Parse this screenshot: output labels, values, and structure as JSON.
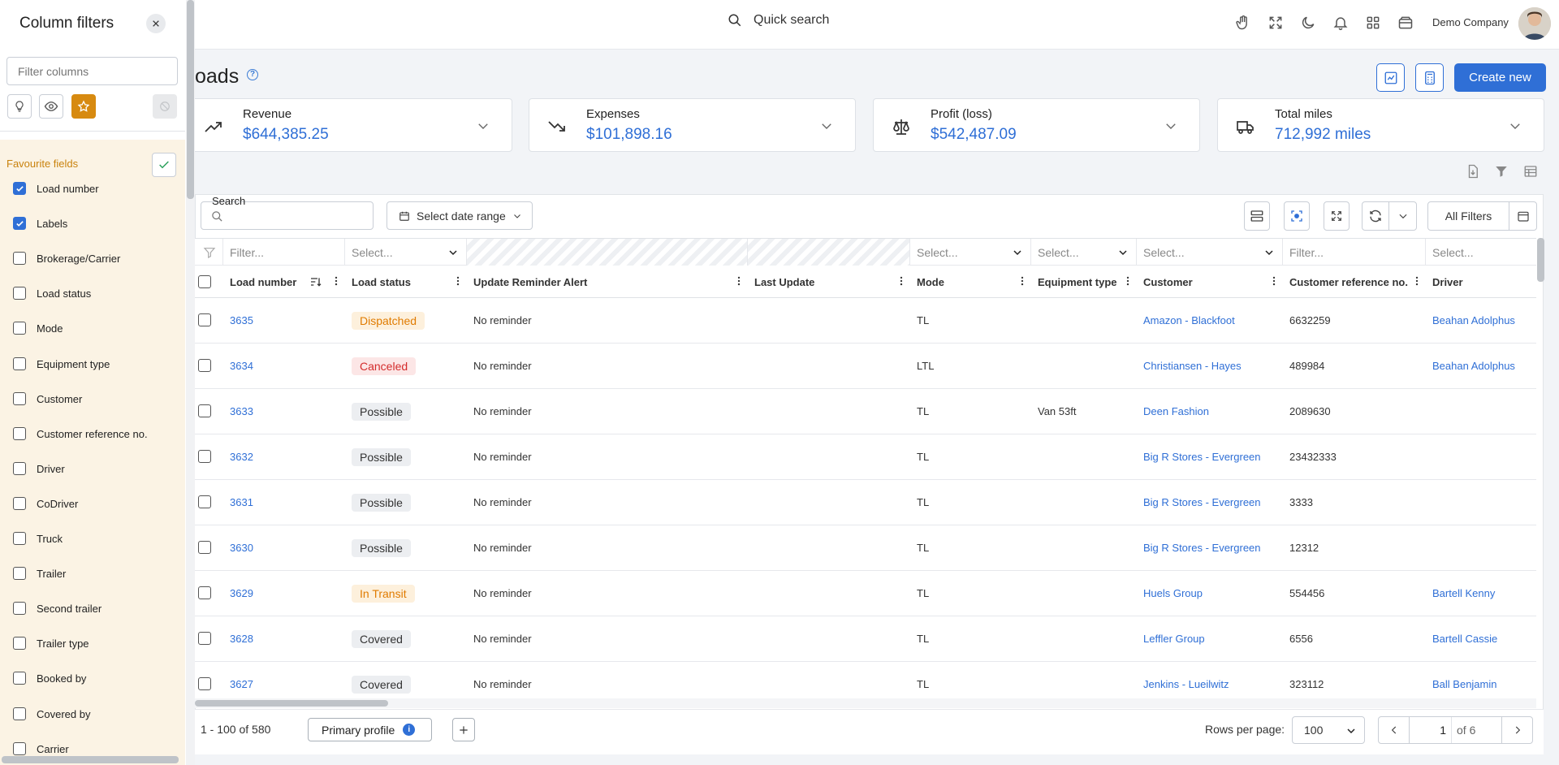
{
  "topbar": {
    "quick_search": "Quick search",
    "company": "Demo Company"
  },
  "page": {
    "title": "oads",
    "create_new": "Create new"
  },
  "stats": [
    {
      "label": "Revenue",
      "value": "$644,385.25",
      "icon": "trend-up-icon"
    },
    {
      "label": "Expenses",
      "value": "$101,898.16",
      "icon": "trend-down-icon"
    },
    {
      "label": "Profit (loss)",
      "value": "$542,487.09",
      "icon": "scale-icon"
    },
    {
      "label": "Total miles",
      "value": "712,992 miles",
      "icon": "truck-icon"
    }
  ],
  "toolbar": {
    "search_label": "Search",
    "date_range": "Select date range",
    "all_filters": "All Filters"
  },
  "filters": {
    "text": "Filter...",
    "select": "Select..."
  },
  "columns": [
    "Load number",
    "Load status",
    "Update Reminder Alert",
    "Last Update",
    "Mode",
    "Equipment type",
    "Customer",
    "Customer reference no.",
    "Driver"
  ],
  "rows": [
    {
      "load": "3635",
      "status": "Dispatched",
      "status_kind": "orange",
      "reminder": "No reminder",
      "mode": "TL",
      "equipment": "",
      "customer": "Amazon - Blackfoot",
      "ref": "6632259",
      "driver": "Beahan Adolphus"
    },
    {
      "load": "3634",
      "status": "Canceled",
      "status_kind": "red",
      "reminder": "No reminder",
      "mode": "LTL",
      "equipment": "",
      "customer": "Christiansen - Hayes",
      "ref": "489984",
      "driver": "Beahan Adolphus"
    },
    {
      "load": "3633",
      "status": "Possible",
      "status_kind": "gray",
      "reminder": "No reminder",
      "mode": "TL",
      "equipment": "Van 53ft",
      "customer": "Deen Fashion",
      "ref": "2089630",
      "driver": ""
    },
    {
      "load": "3632",
      "status": "Possible",
      "status_kind": "gray",
      "reminder": "No reminder",
      "mode": "TL",
      "equipment": "",
      "customer": "Big R Stores - Evergreen",
      "ref": "23432333",
      "driver": ""
    },
    {
      "load": "3631",
      "status": "Possible",
      "status_kind": "gray",
      "reminder": "No reminder",
      "mode": "TL",
      "equipment": "",
      "customer": "Big R Stores - Evergreen",
      "ref": "3333",
      "driver": ""
    },
    {
      "load": "3630",
      "status": "Possible",
      "status_kind": "gray",
      "reminder": "No reminder",
      "mode": "TL",
      "equipment": "",
      "customer": "Big R Stores - Evergreen",
      "ref": "12312",
      "driver": ""
    },
    {
      "load": "3629",
      "status": "In Transit",
      "status_kind": "orange",
      "reminder": "No reminder",
      "mode": "TL",
      "equipment": "",
      "customer": "Huels Group",
      "ref": "554456",
      "driver": "Bartell Kenny"
    },
    {
      "load": "3628",
      "status": "Covered",
      "status_kind": "gray",
      "reminder": "No reminder",
      "mode": "TL",
      "equipment": "",
      "customer": "Leffler Group",
      "ref": "6556",
      "driver": "Bartell Cassie"
    },
    {
      "load": "3627",
      "status": "Covered",
      "status_kind": "gray",
      "reminder": "No reminder",
      "mode": "TL",
      "equipment": "",
      "customer": "Jenkins - Lueilwitz",
      "ref": "323112",
      "driver": "Ball Benjamin"
    }
  ],
  "footer": {
    "range": "1 - 100 of 580",
    "profile": "Primary profile",
    "rows_per_page_label": "Rows per page:",
    "rows_per_page": "100",
    "page": "1",
    "of_pages": "of 6"
  },
  "side_panel": {
    "title": "Column filters",
    "filter_placeholder": "Filter columns",
    "favourites_title": "Favourite fields",
    "fields": [
      {
        "label": "Load number",
        "checked": true
      },
      {
        "label": "Labels",
        "checked": true
      },
      {
        "label": "Brokerage/Carrier",
        "checked": false
      },
      {
        "label": "Load status",
        "checked": false
      },
      {
        "label": "Mode",
        "checked": false
      },
      {
        "label": "Equipment type",
        "checked": false
      },
      {
        "label": "Customer",
        "checked": false
      },
      {
        "label": "Customer reference no.",
        "checked": false
      },
      {
        "label": "Driver",
        "checked": false
      },
      {
        "label": "CoDriver",
        "checked": false
      },
      {
        "label": "Truck",
        "checked": false
      },
      {
        "label": "Trailer",
        "checked": false
      },
      {
        "label": "Second trailer",
        "checked": false
      },
      {
        "label": "Trailer type",
        "checked": false
      },
      {
        "label": "Booked by",
        "checked": false
      },
      {
        "label": "Covered by",
        "checked": false
      },
      {
        "label": "Carrier",
        "checked": false
      }
    ]
  },
  "colors": {
    "accent": "#2f6fd6",
    "orange": "#e07b00",
    "red": "#d42c2c",
    "fav_bg": "#fbf3e4"
  }
}
